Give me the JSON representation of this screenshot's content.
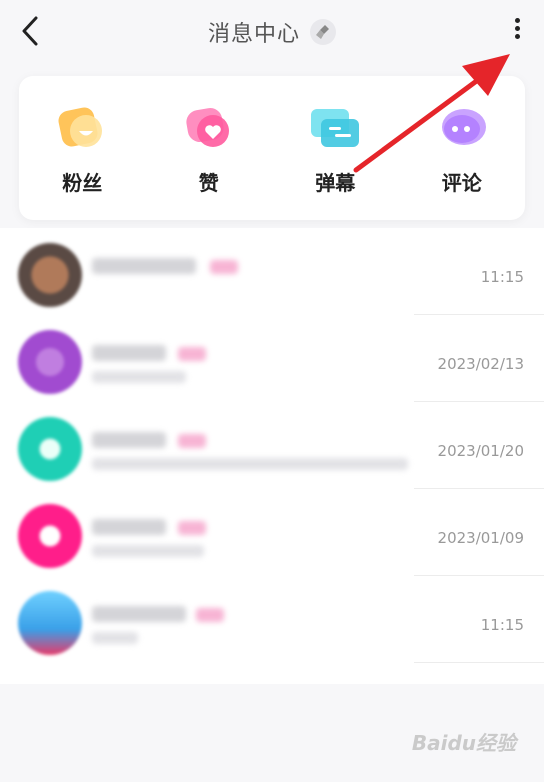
{
  "header": {
    "title": "消息中心"
  },
  "categories": [
    {
      "label": "粉丝",
      "icon": "fans-icon",
      "color": "#ffb74d"
    },
    {
      "label": "赞",
      "icon": "like-heart-icon",
      "color": "#ff6fa8"
    },
    {
      "label": "弹幕",
      "icon": "danmaku-icon",
      "color": "#4dd0e1"
    },
    {
      "label": "评论",
      "icon": "comment-icon",
      "color": "#c58bff"
    }
  ],
  "messages": [
    {
      "time": "11:15",
      "avatar_color": "#6b4e3d"
    },
    {
      "time": "2023/02/13",
      "avatar_color": "#a14bd0"
    },
    {
      "time": "2023/01/20",
      "avatar_color": "#1fcfb5"
    },
    {
      "time": "2023/01/09",
      "avatar_color": "#ff1e8a"
    },
    {
      "time": "11:15",
      "avatar_color": "#3aa0e8"
    }
  ],
  "watermark": "Baidu经验"
}
